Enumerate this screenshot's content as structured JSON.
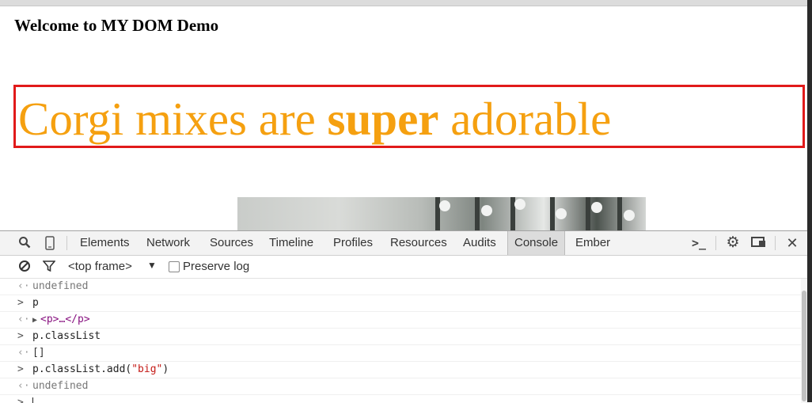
{
  "page": {
    "heading": "Welcome to MY DOM Demo",
    "hero_text_part1": "Corgi mixes are ",
    "hero_text_bold": "super",
    "hero_text_part2": " adorable"
  },
  "devtools": {
    "tabs": [
      "Elements",
      "Network",
      "Sources",
      "Timeline",
      "Profiles",
      "Resources",
      "Audits",
      "Console",
      "Ember"
    ],
    "active_tab": "Console",
    "frame_select": "<top frame>",
    "preserve_log_label": "Preserve log",
    "preserve_log_checked": false,
    "console_rows": [
      {
        "type": "out",
        "text": "undefined"
      },
      {
        "type": "in",
        "text": "p"
      },
      {
        "type": "out",
        "text": "<p>…</p>"
      },
      {
        "type": "in",
        "text": "p.classList"
      },
      {
        "type": "out",
        "text": "[]"
      },
      {
        "type": "in",
        "text": "p.classList.add(\"big\")"
      },
      {
        "type": "out",
        "text": "undefined"
      }
    ]
  },
  "colors": {
    "hero_text": "#f5a010",
    "hero_border": "#e11a1a",
    "tag_purple": "#881280",
    "string_red": "#c41a16",
    "prompt_blue": "#3a7bd5"
  },
  "icons": [
    "search-icon",
    "device-mode-icon",
    "console-drawer-icon",
    "gear-icon",
    "dock-side-icon",
    "close-icon",
    "clear-console-icon",
    "filter-icon",
    "dropdown-arrow-icon"
  ]
}
